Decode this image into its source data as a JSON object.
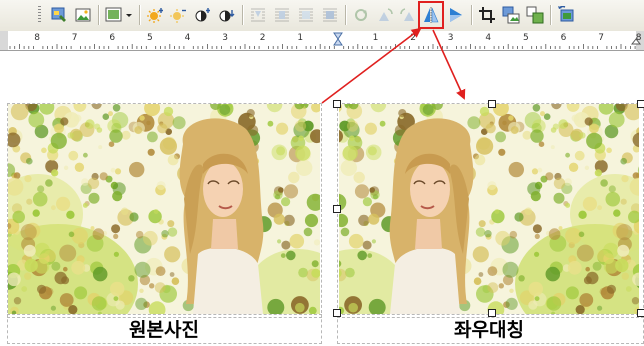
{
  "toolbar": {
    "buttons": [
      {
        "name": "picture-properties-icon",
        "disabled": false
      },
      {
        "name": "picture-insert-icon",
        "disabled": false
      },
      {
        "name": "picture-style-icon",
        "disabled": false
      },
      {
        "name": "brightness-up-icon",
        "disabled": false
      },
      {
        "name": "brightness-down-icon",
        "disabled": false
      },
      {
        "name": "contrast-up-icon",
        "disabled": false
      },
      {
        "name": "contrast-down-icon",
        "disabled": false
      },
      {
        "name": "wrap-square-icon",
        "disabled": true
      },
      {
        "name": "wrap-tight-icon",
        "disabled": true
      },
      {
        "name": "wrap-behind-icon",
        "disabled": true
      },
      {
        "name": "wrap-front-icon",
        "disabled": true
      },
      {
        "name": "rotate-free-icon",
        "disabled": true
      },
      {
        "name": "rotate-left-icon",
        "disabled": true
      },
      {
        "name": "rotate-right-icon",
        "disabled": true
      },
      {
        "name": "flip-horizontal-icon",
        "disabled": false,
        "highlighted": true
      },
      {
        "name": "flip-vertical-icon",
        "disabled": false
      },
      {
        "name": "crop-icon",
        "disabled": false
      },
      {
        "name": "picture-size-icon",
        "disabled": false
      },
      {
        "name": "picture-group-icon",
        "disabled": false
      },
      {
        "name": "picture-reset-icon",
        "disabled": false
      }
    ]
  },
  "ruler": {
    "labels": [
      "8",
      "7",
      "6",
      "5",
      "4",
      "3",
      "2",
      "1",
      "1",
      "2",
      "3",
      "4",
      "5",
      "6",
      "7",
      "8"
    ]
  },
  "images": [
    {
      "caption": "원본사진",
      "mirrored": false
    },
    {
      "caption": "좌우대칭",
      "mirrored": true
    }
  ],
  "colors": {
    "highlight": "#e0201f",
    "arrow": "#e0201f"
  }
}
